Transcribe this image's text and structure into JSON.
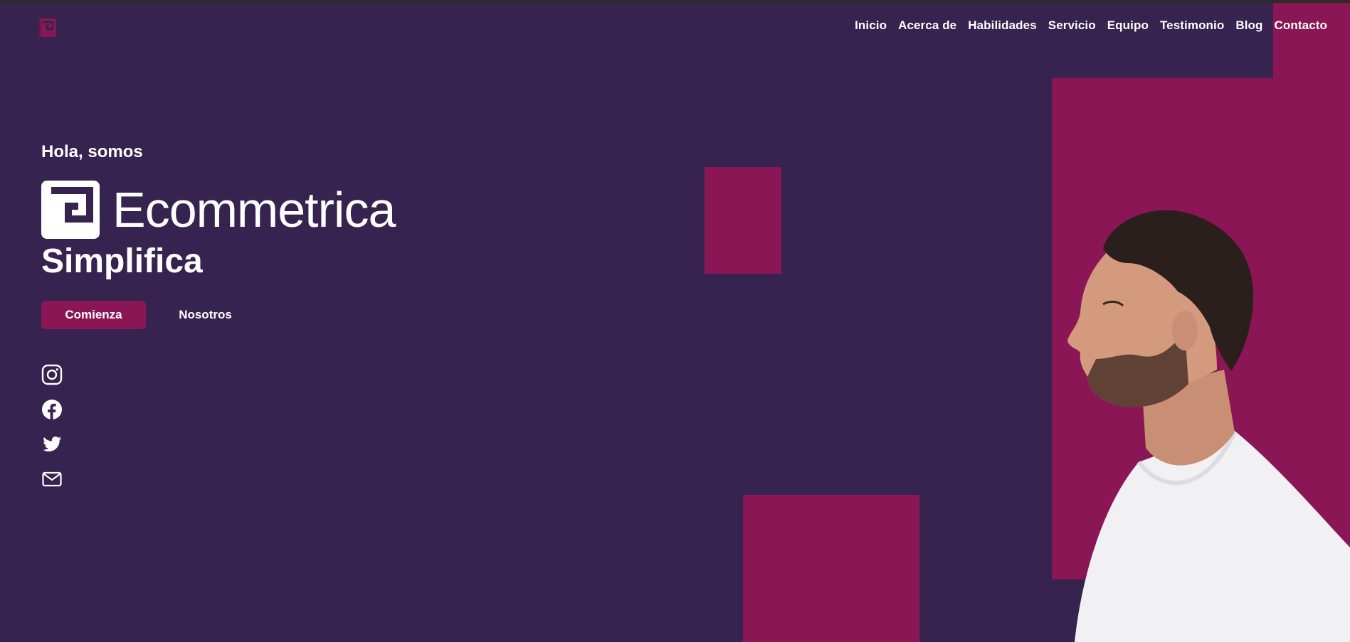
{
  "nav": {
    "items": [
      {
        "label": "Inicio"
      },
      {
        "label": "Acerca de"
      },
      {
        "label": "Habilidades"
      },
      {
        "label": "Servicio"
      },
      {
        "label": "Equipo"
      },
      {
        "label": "Testimonio"
      },
      {
        "label": "Blog"
      },
      {
        "label": "Contacto"
      }
    ]
  },
  "hero": {
    "greeting": "Hola, somos",
    "brand_name": "Ecommetrica",
    "tagline": "Simplifica",
    "primary_button": "Comienza",
    "secondary_button": "Nosotros"
  },
  "social": {
    "icons": [
      "instagram-icon",
      "facebook-icon",
      "twitter-icon",
      "mail-icon"
    ]
  },
  "colors": {
    "background": "#37234f",
    "accent": "#8a1655",
    "text": "#ffffff"
  }
}
